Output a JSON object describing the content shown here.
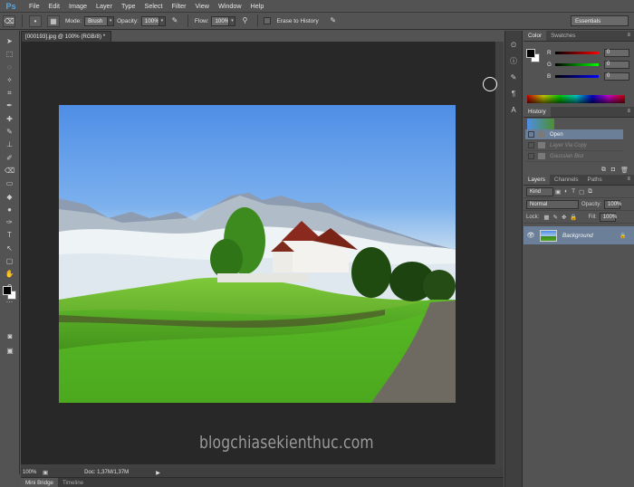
{
  "app": {
    "logo": "Ps"
  },
  "menu": [
    "File",
    "Edit",
    "Image",
    "Layer",
    "Type",
    "Select",
    "Filter",
    "View",
    "Window",
    "Help"
  ],
  "options": {
    "mode_label": "Mode:",
    "mode_value": "Brush",
    "opacity_label": "Opacity:",
    "opacity_value": "100%",
    "flow_label": "Flow:",
    "flow_value": "100%",
    "erase_history": "Erase to History",
    "workspace": "Essentials"
  },
  "document": {
    "tab_title": "[000193].jpg @ 100% (RGB/8) *",
    "zoom": "100%",
    "doc_info": "Doc: 1,37M/1,37M"
  },
  "bottom_tabs": [
    "Mini Bridge",
    "Timeline"
  ],
  "color_panel": {
    "tabs": [
      "Color",
      "Swatches"
    ],
    "sliders": [
      {
        "letter": "R",
        "value": "0",
        "gradient": "linear-gradient(90deg,#000,#f00)"
      },
      {
        "letter": "G",
        "value": "0",
        "gradient": "linear-gradient(90deg,#000,#0f0)"
      },
      {
        "letter": "B",
        "value": "0",
        "gradient": "linear-gradient(90deg,#000,#00f)"
      }
    ]
  },
  "history_panel": {
    "tab": "History",
    "items": [
      {
        "label": "Open",
        "state": "active"
      },
      {
        "label": "Layer Via Copy",
        "state": "ghost"
      },
      {
        "label": "Gaussian Blur",
        "state": "ghost"
      }
    ]
  },
  "layers_panel": {
    "tabs": [
      "Layers",
      "Channels",
      "Paths"
    ],
    "kind_label": "Kind",
    "blend_mode": "Normal",
    "opacity_label": "Opacity:",
    "opacity_value": "100%",
    "lock_label": "Lock:",
    "fill_label": "Fill:",
    "fill_value": "100%",
    "layer_name": "Background"
  },
  "watermark": "blogchiasekienthuc.com"
}
